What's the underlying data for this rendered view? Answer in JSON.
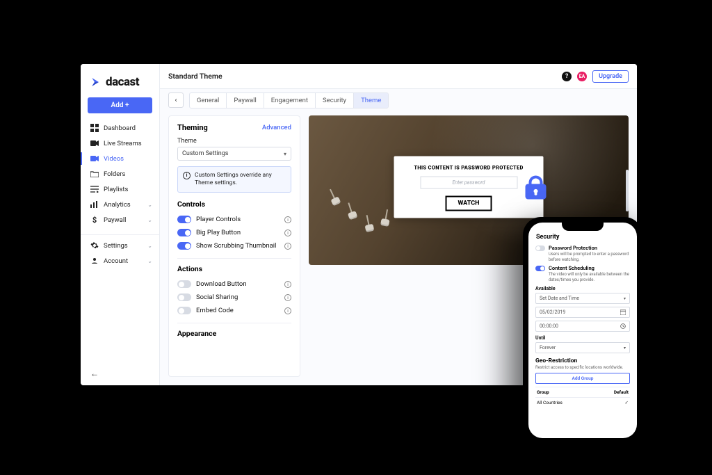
{
  "logo": {
    "text": "dacast"
  },
  "sidebar": {
    "add_button": "Add +",
    "items1": [
      {
        "label": "Dashboard"
      },
      {
        "label": "Live Streams"
      },
      {
        "label": "Videos"
      },
      {
        "label": "Folders"
      },
      {
        "label": "Playlists"
      },
      {
        "label": "Analytics"
      },
      {
        "label": "Paywall"
      }
    ],
    "items2": [
      {
        "label": "Settings"
      },
      {
        "label": "Account"
      }
    ]
  },
  "header": {
    "title": "Standard Theme",
    "avatar_initials": "EA",
    "upgrade": "Upgrade"
  },
  "tabs": [
    "General",
    "Paywall",
    "Engagement",
    "Security",
    "Theme"
  ],
  "theming": {
    "heading": "Theming",
    "advanced": "Advanced",
    "theme_label": "Theme",
    "theme_value": "Custom Settings",
    "notice": "Custom Settings override any Theme settings.",
    "controls_heading": "Controls",
    "controls": [
      {
        "label": "Player Controls",
        "on": true
      },
      {
        "label": "Big Play Button",
        "on": true
      },
      {
        "label": "Show Scrubbing Thumbnail",
        "on": true
      }
    ],
    "actions_heading": "Actions",
    "actions": [
      {
        "label": "Download Button",
        "on": false
      },
      {
        "label": "Social Sharing",
        "on": false
      },
      {
        "label": "Embed Code",
        "on": false
      }
    ],
    "appearance_heading": "Appearance"
  },
  "preview": {
    "overlay_title": "THIS CONTENT IS PASSWORD PROTECTED",
    "placeholder": "Enter password",
    "watch": "WATCH"
  },
  "phone": {
    "security_heading": "Security",
    "pw_title": "Password Protection",
    "pw_desc": "Users will be prompted to enter a password before watching.",
    "sched_title": "Content Scheduling",
    "sched_desc": "The video will only be available between the dates/times you provide.",
    "available_label": "Available",
    "available_select": "Set Date and Time",
    "date": "05/02/2019",
    "time": "00:00:00",
    "until_label": "Until",
    "until_value": "Forever",
    "geo_heading": "Geo-Restriction",
    "geo_desc": "Restrict access to specific locations worldwide.",
    "add_group": "Add Group",
    "col_group": "Group",
    "col_default": "Default",
    "row_group": "All Countries"
  }
}
